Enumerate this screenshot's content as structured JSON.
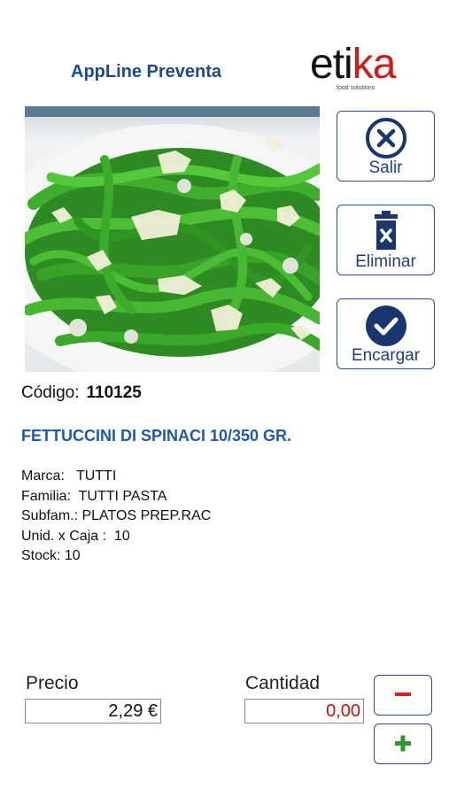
{
  "header": {
    "app_title": "AppLine Preventa",
    "logo_text": "etika",
    "logo_tagline": "food solutions"
  },
  "actions": {
    "exit_label": "Salir",
    "delete_label": "Eliminar",
    "order_label": "Encargar"
  },
  "product": {
    "code_label": "Código:",
    "code_value": "110125",
    "name": "FETTUCCINI DI SPINACI 10/350 GR.",
    "brand": "Marca:   TUTTI",
    "family": "Familia:  TUTTI PASTA",
    "subfamily": "Subfam.: PLATOS PREP.RAC",
    "units_per_box": "Unid. x Caja :  10",
    "stock": "Stock: 10",
    "photo_icon": "pasta-photo"
  },
  "order": {
    "price_label": "Precio",
    "price_value": "2,29 €",
    "quantity_label": "Cantidad",
    "quantity_value": "0,00",
    "quantity_color": "#cc1111",
    "decrement_icon": "minus-icon",
    "increment_icon": "plus-icon"
  },
  "colors": {
    "title_blue": "#1f4a8a",
    "product_name_blue": "#1f5aa8",
    "button_border": "#2c4d8f",
    "icon_navy": "#1a3670",
    "minus_red": "#d42020",
    "plus_green": "#2e9a2e"
  }
}
